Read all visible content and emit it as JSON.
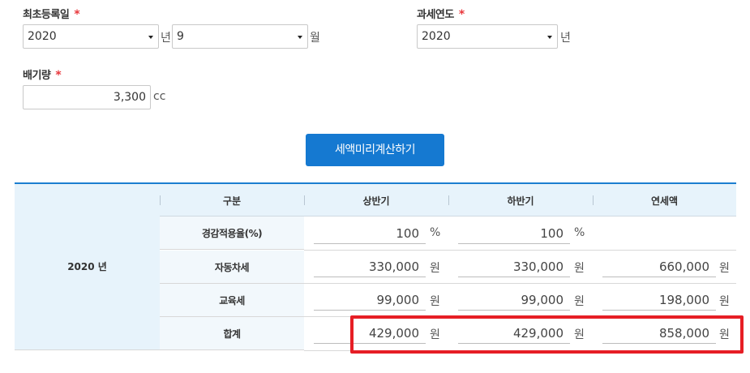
{
  "form": {
    "reg_date_label": "최초등록일",
    "required_mark": "*",
    "reg_year_value": "2020",
    "year_unit": "년",
    "reg_month_value": "9",
    "month_unit": "월",
    "tax_year_label": "과세연도",
    "tax_year_value": "2020",
    "tax_year_unit": "년",
    "displacement_label": "배기량",
    "displacement_value": "3,300",
    "displacement_unit": "cc",
    "calc_button": "세액미리계산하기"
  },
  "table": {
    "year_label": "2020 년",
    "headers": [
      "구분",
      "상반기",
      "하반기",
      "연세액"
    ],
    "rows": [
      {
        "label": "경감적용율(%)",
        "first_half": "100",
        "second_half": "100",
        "annual": "",
        "unit": "%",
        "annual_unit": ""
      },
      {
        "label": "자동차세",
        "first_half": "330,000",
        "second_half": "330,000",
        "annual": "660,000",
        "unit": "원",
        "annual_unit": "원"
      },
      {
        "label": "교육세",
        "first_half": "99,000",
        "second_half": "99,000",
        "annual": "198,000",
        "unit": "원",
        "annual_unit": "원"
      },
      {
        "label": "합계",
        "first_half": "429,000",
        "second_half": "429,000",
        "annual": "858,000",
        "unit": "원",
        "annual_unit": "원"
      }
    ]
  },
  "colors": {
    "accent": "#1579d1",
    "highlight": "#e61e25",
    "required": "#e8373c"
  }
}
